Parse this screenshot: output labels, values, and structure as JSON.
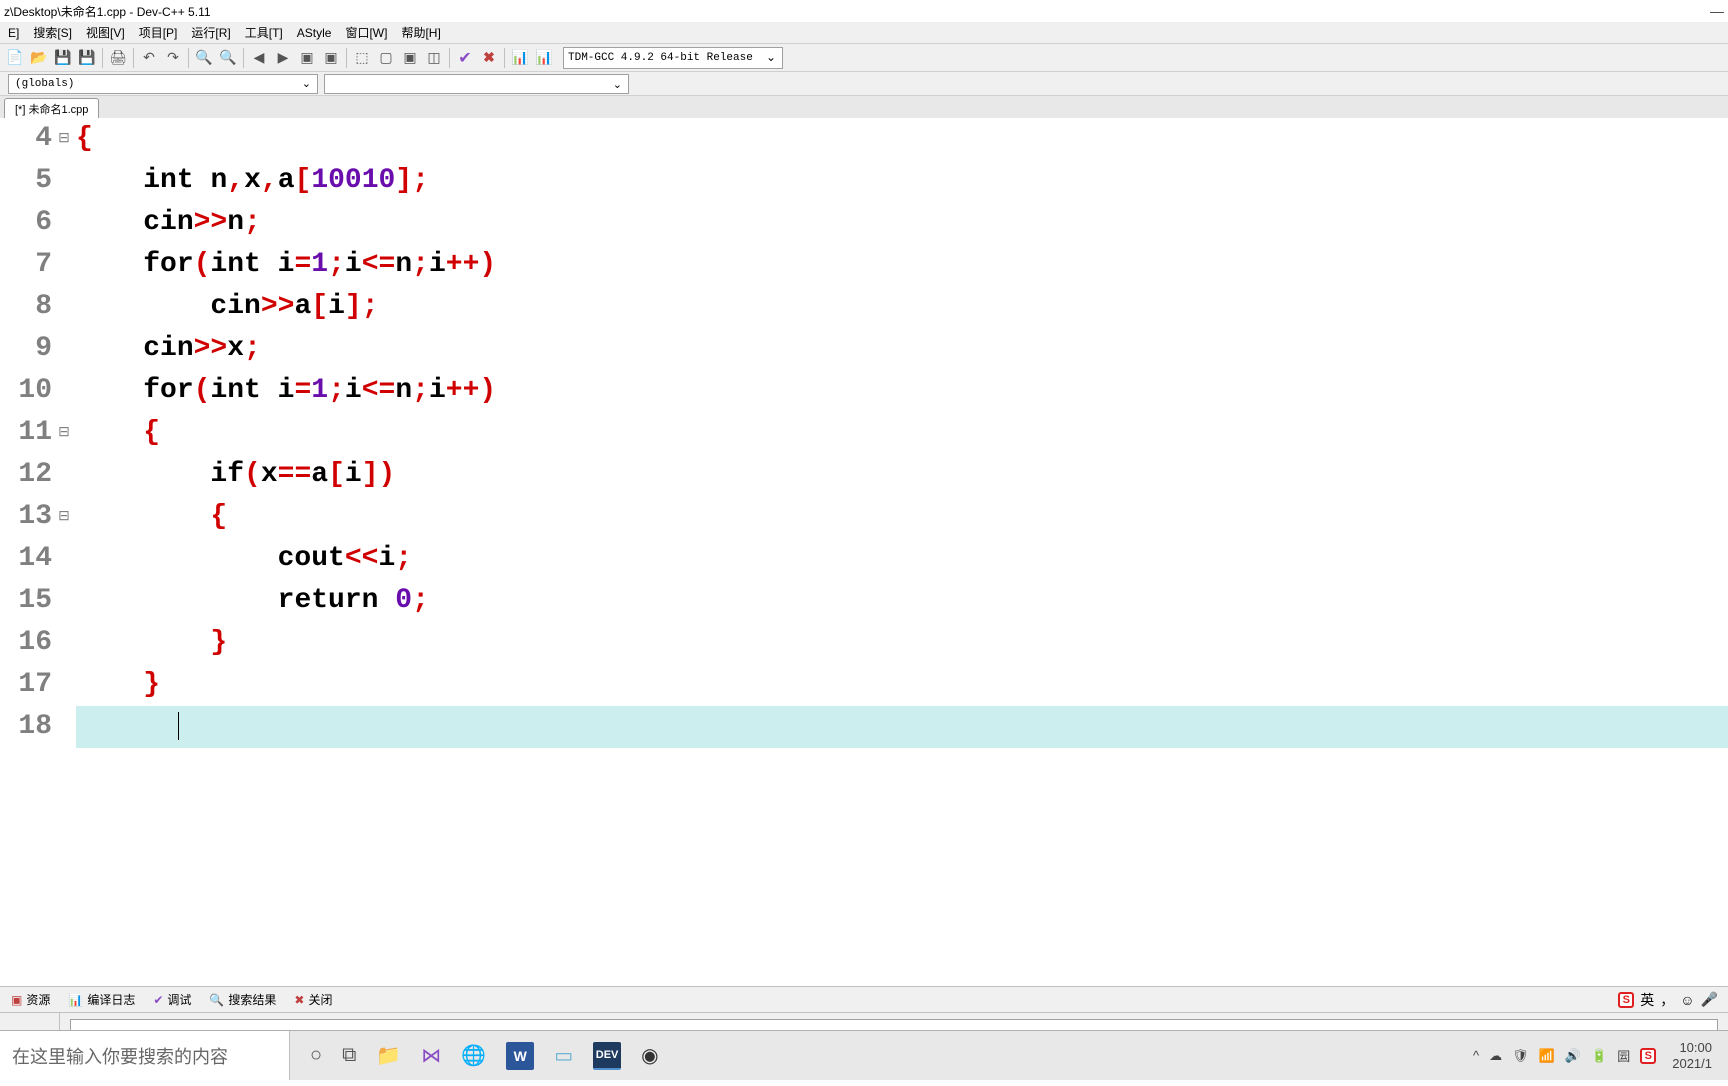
{
  "titlebar": {
    "path": "z\\Desktop\\未命名1.cpp - Dev-C++ 5.11"
  },
  "menu": {
    "file": "E]",
    "search": "搜索[S]",
    "view": "视图[V]",
    "project": "项目[P]",
    "run": "运行[R]",
    "tools": "工具[T]",
    "astyle": "AStyle",
    "window": "窗口[W]",
    "help": "帮助[H]"
  },
  "toolbar": {
    "compiler": "TDM-GCC 4.9.2 64-bit Release"
  },
  "scope": {
    "globals": "(globals)"
  },
  "tabs": {
    "file": "[*] 未命名1.cpp"
  },
  "code": {
    "lines": [
      {
        "n": "4",
        "fold": "⊟",
        "html": "<span class='brace'>{</span>"
      },
      {
        "n": "5",
        "fold": "",
        "html": "    <span class='kw'>int</span> n<span class='punct'>,</span>x<span class='punct'>,</span>a<span class='punct'>[</span><span class='num'>10010</span><span class='punct'>];</span>"
      },
      {
        "n": "6",
        "fold": "",
        "html": "    cin<span class='op'>&gt;&gt;</span>n<span class='punct'>;</span>"
      },
      {
        "n": "7",
        "fold": "",
        "html": "    <span class='kw'>for</span><span class='punct'>(</span><span class='kw'>int</span> i<span class='op'>=</span><span class='num'>1</span><span class='punct'>;</span>i<span class='op'>&lt;=</span>n<span class='punct'>;</span>i<span class='op'>++</span><span class='punct'>)</span>"
      },
      {
        "n": "8",
        "fold": "",
        "html": "        cin<span class='op'>&gt;&gt;</span>a<span class='punct'>[</span>i<span class='punct'>];</span>"
      },
      {
        "n": "9",
        "fold": "",
        "html": "    cin<span class='op'>&gt;&gt;</span>x<span class='punct'>;</span>"
      },
      {
        "n": "10",
        "fold": "",
        "html": "    <span class='kw'>for</span><span class='punct'>(</span><span class='kw'>int</span> i<span class='op'>=</span><span class='num'>1</span><span class='punct'>;</span>i<span class='op'>&lt;=</span>n<span class='punct'>;</span>i<span class='op'>++</span><span class='punct'>)</span>"
      },
      {
        "n": "11",
        "fold": "⊟",
        "html": "    <span class='brace'>{</span>"
      },
      {
        "n": "12",
        "fold": "",
        "html": "        <span class='kw'>if</span><span class='punct'>(</span>x<span class='op'>==</span>a<span class='punct'>[</span>i<span class='punct'>])</span>"
      },
      {
        "n": "13",
        "fold": "⊟",
        "html": "        <span class='brace'>{</span>"
      },
      {
        "n": "14",
        "fold": "",
        "html": "            cout<span class='op'>&lt;&lt;</span>i<span class='punct'>;</span>"
      },
      {
        "n": "15",
        "fold": "",
        "html": "            <span class='kw'>return</span> <span class='num'>0</span><span class='punct'>;</span>"
      },
      {
        "n": "16",
        "fold": "",
        "html": "        <span class='brace'>}</span>"
      },
      {
        "n": "17",
        "fold": "",
        "html": "    <span class='brace'>}</span>"
      },
      {
        "n": "18",
        "fold": "",
        "html": "    <span class='caret'></span>",
        "active": true
      }
    ]
  },
  "bottomtabs": {
    "resource": "资源",
    "compilelog": "编译日志",
    "debug": "调试",
    "searchresult": "搜索结果",
    "close": "关闭"
  },
  "ime": {
    "lang": "英",
    "p1": "，",
    "p2": "☺",
    "p3": "🎤"
  },
  "taskbar": {
    "search_placeholder": "在这里输入你要搜索的内容"
  },
  "clock": {
    "time": "10:00",
    "date": "2021/1"
  }
}
